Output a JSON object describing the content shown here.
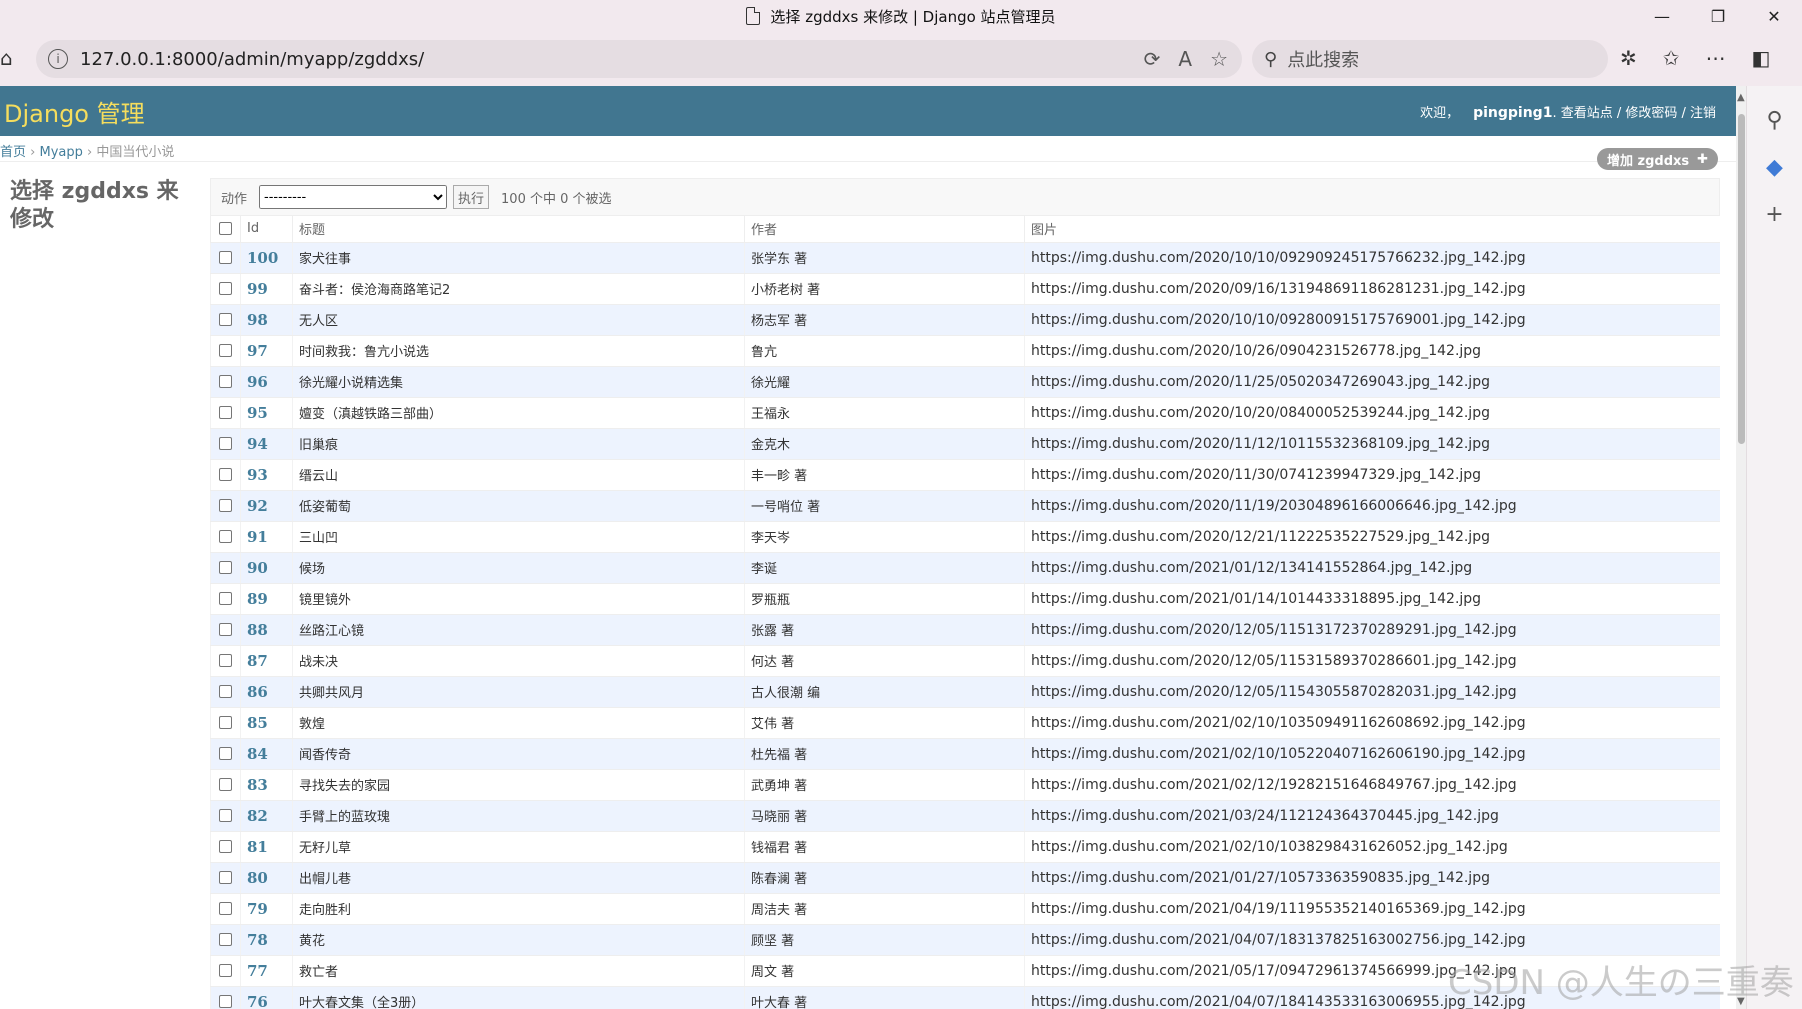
{
  "browser": {
    "tab_title": "选择 zgddxs 来修改 | Django 站点管理员",
    "url": "127.0.0.1:8000/admin/myapp/zgddxs/",
    "search_placeholder": "点此搜索"
  },
  "header": {
    "brand": "Django 管理",
    "welcome": "欢迎，",
    "username": "pingping1",
    "links": ". 查看站点 / 修改密码 / 注销"
  },
  "breadcrumbs": {
    "home": "首页",
    "app": "Myapp",
    "sep": "›",
    "current": "中国当代小说"
  },
  "page_title": "选择 zgddxs 来修改",
  "add_button": "增加 zgddxs",
  "actions": {
    "label": "动作",
    "selected": "---------",
    "go_label": "执行",
    "counter": "100 个中 0 个被选"
  },
  "table": {
    "headers": [
      "Id",
      "标题",
      "作者",
      "图片"
    ],
    "rows": [
      {
        "id": "100",
        "title": "家犬往事",
        "author": "张学东 著",
        "image": "https://img.dushu.com/2020/10/10/092909245175766232.jpg_142.jpg"
      },
      {
        "id": "99",
        "title": "奋斗者：侯沧海商路笔记2",
        "author": "小桥老树 著",
        "image": "https://img.dushu.com/2020/09/16/131948691186281231.jpg_142.jpg"
      },
      {
        "id": "98",
        "title": "无人区",
        "author": "杨志军 著",
        "image": "https://img.dushu.com/2020/10/10/092800915175769001.jpg_142.jpg"
      },
      {
        "id": "97",
        "title": "时间救我：鲁亢小说选",
        "author": "鲁亢",
        "image": "https://img.dushu.com/2020/10/26/0904231526778.jpg_142.jpg"
      },
      {
        "id": "96",
        "title": "徐光耀小说精选集",
        "author": "徐光耀",
        "image": "https://img.dushu.com/2020/11/25/05020347269043.jpg_142.jpg"
      },
      {
        "id": "95",
        "title": "嬗变（滇越铁路三部曲）",
        "author": "王福永",
        "image": "https://img.dushu.com/2020/10/20/08400052539244.jpg_142.jpg"
      },
      {
        "id": "94",
        "title": "旧巢痕",
        "author": "金克木",
        "image": "https://img.dushu.com/2020/11/12/10115532368109.jpg_142.jpg"
      },
      {
        "id": "93",
        "title": "缙云山",
        "author": "丰一畛 著",
        "image": "https://img.dushu.com/2020/11/30/0741239947329.jpg_142.jpg"
      },
      {
        "id": "92",
        "title": "低姿葡萄",
        "author": "一号哨位 著",
        "image": "https://img.dushu.com/2020/11/19/20304896166006646.jpg_142.jpg"
      },
      {
        "id": "91",
        "title": "三山凹",
        "author": "李天岑",
        "image": "https://img.dushu.com/2020/12/21/11222535227529.jpg_142.jpg"
      },
      {
        "id": "90",
        "title": "候场",
        "author": "李诞",
        "image": "https://img.dushu.com/2021/01/12/134141552864.jpg_142.jpg"
      },
      {
        "id": "89",
        "title": "镜里镜外",
        "author": "罗瓶瓶",
        "image": "https://img.dushu.com/2021/01/14/1014433318895.jpg_142.jpg"
      },
      {
        "id": "88",
        "title": "丝路江心镜",
        "author": "张露 著",
        "image": "https://img.dushu.com/2020/12/05/11513172370289291.jpg_142.jpg"
      },
      {
        "id": "87",
        "title": "战未决",
        "author": "何达 著",
        "image": "https://img.dushu.com/2020/12/05/11531589370286601.jpg_142.jpg"
      },
      {
        "id": "86",
        "title": "共卿共风月",
        "author": "古人很潮 编",
        "image": "https://img.dushu.com/2020/12/05/11543055870282031.jpg_142.jpg"
      },
      {
        "id": "85",
        "title": "敦煌",
        "author": "艾伟 著",
        "image": "https://img.dushu.com/2021/02/10/103509491162608692.jpg_142.jpg"
      },
      {
        "id": "84",
        "title": "闻香传奇",
        "author": "杜先福 著",
        "image": "https://img.dushu.com/2021/02/10/105220407162606190.jpg_142.jpg"
      },
      {
        "id": "83",
        "title": "寻找失去的家园",
        "author": "武勇坤 著",
        "image": "https://img.dushu.com/2021/02/12/19282151646849767.jpg_142.jpg"
      },
      {
        "id": "82",
        "title": "手臂上的蓝玫瑰",
        "author": "马晓丽 著",
        "image": "https://img.dushu.com/2021/03/24/112124364370445.jpg_142.jpg"
      },
      {
        "id": "81",
        "title": "无籽儿草",
        "author": "钱福君 著",
        "image": "https://img.dushu.com/2021/02/10/1038298431626052.jpg_142.jpg"
      },
      {
        "id": "80",
        "title": "出帽儿巷",
        "author": "陈春澜 著",
        "image": "https://img.dushu.com/2021/01/27/10573363590835.jpg_142.jpg"
      },
      {
        "id": "79",
        "title": "走向胜利",
        "author": "周洁夫 著",
        "image": "https://img.dushu.com/2021/04/19/111955352140165369.jpg_142.jpg"
      },
      {
        "id": "78",
        "title": "黄花",
        "author": "顾坚 著",
        "image": "https://img.dushu.com/2021/04/07/183137825163002756.jpg_142.jpg"
      },
      {
        "id": "77",
        "title": "救亡者",
        "author": "周文 著",
        "image": "https://img.dushu.com/2021/05/17/09472961374566999.jpg_142.jpg"
      },
      {
        "id": "76",
        "title": "叶大春文集（全3册）",
        "author": "叶大春 著",
        "image": "https://img.dushu.com/2021/04/07/184143533163006955.jpg_142.jpg"
      }
    ]
  },
  "watermark": "CSDN @人生の三重奏",
  "colors": {
    "header_bg": "#417690",
    "brand": "#f5dd5d",
    "link": "#447e9b",
    "row_alt": "#edf3fe"
  }
}
